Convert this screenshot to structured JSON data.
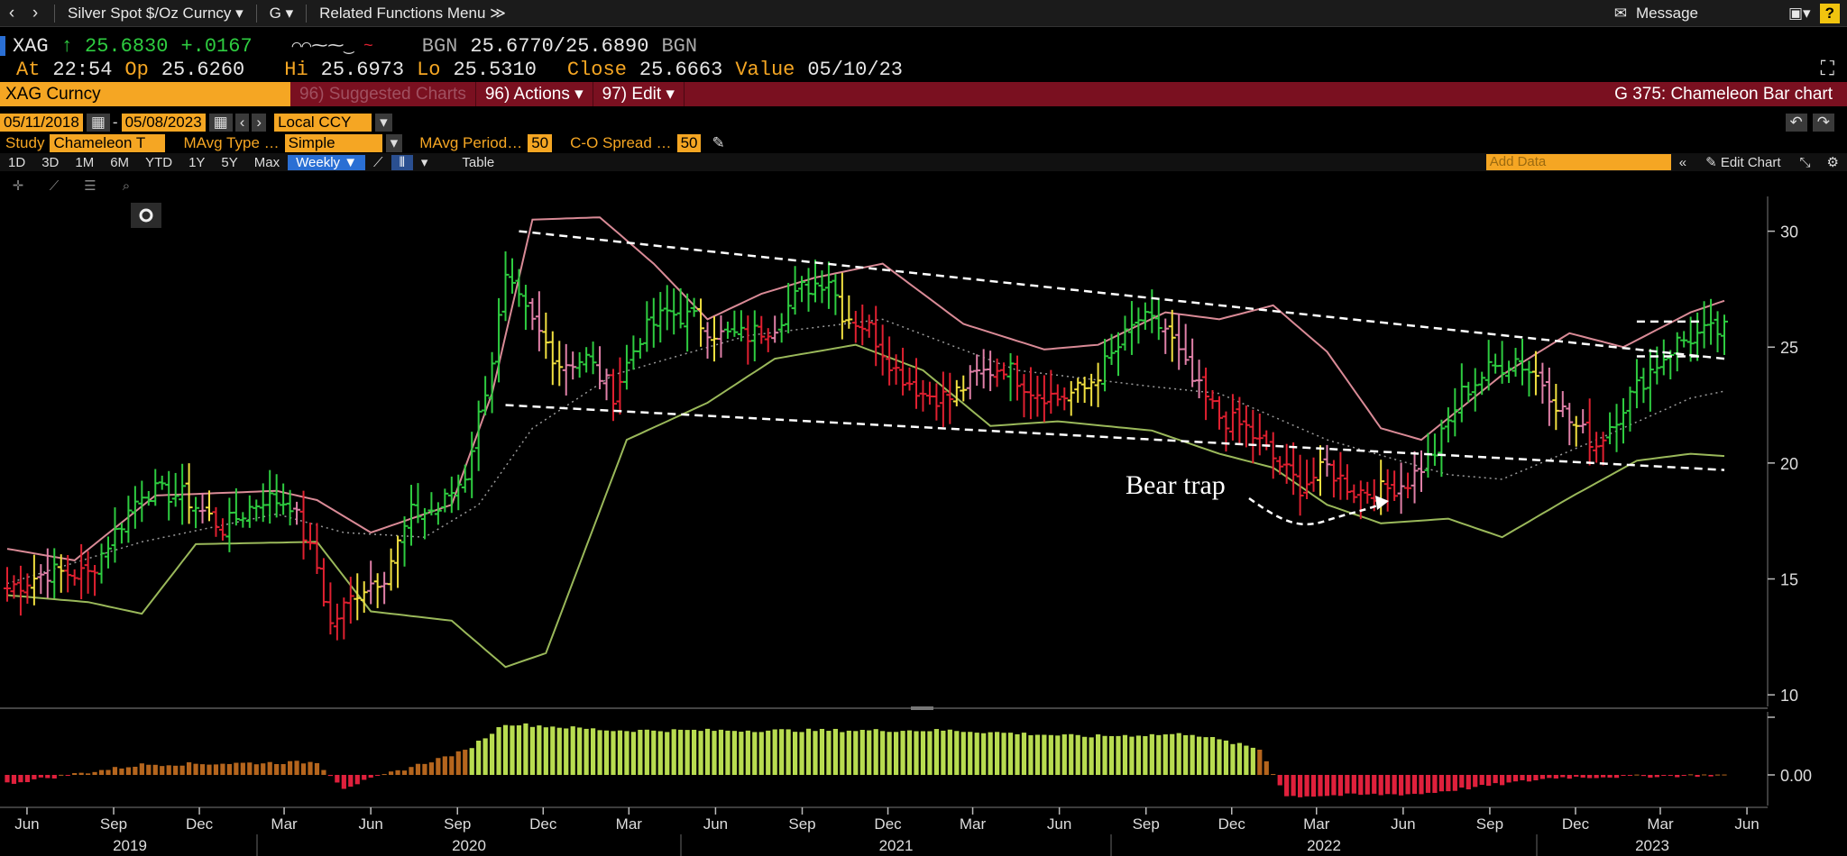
{
  "topbar": {
    "security_menu": "Silver Spot $/Oz Curncy ▾",
    "g_menu": "G ▾",
    "related": "Related Functions Menu ≫",
    "message": "Message",
    "help": "?"
  },
  "quote": {
    "ticker": "XAG",
    "last": "↑ 25.6830",
    "change": "+.0167",
    "source1": "BGN",
    "bidask": "25.6770/25.6890",
    "source2": "BGN",
    "at_label": "At",
    "time": "22:54",
    "op_label": "Op",
    "open": "25.6260",
    "hi_label": "Hi",
    "high": "25.6973",
    "lo_label": "Lo",
    "low": "25.5310",
    "close_label": "Close",
    "close": "25.6663",
    "value_label": "Value",
    "value_date": "05/10/23"
  },
  "security_bar": {
    "ticker_field": "XAG Curncy",
    "suggested": "96) Suggested Charts",
    "actions": "96) Actions ▾",
    "edit": "97) Edit ▾",
    "title": "G 375: Chameleon Bar chart"
  },
  "dates": {
    "start": "05/11/2018",
    "end": "05/08/2023",
    "currency": "Local CCY"
  },
  "study": {
    "label": "Study",
    "study_value": "Chameleon T",
    "mavg_type_label": "MAvg Type …",
    "mavg_type_value": "Simple",
    "mavg_period_label": "MAvg Period…",
    "mavg_period_value": "50",
    "co_spread_label": "C-O Spread …",
    "co_spread_value": "50"
  },
  "periods": [
    "1D",
    "3D",
    "1M",
    "6M",
    "YTD",
    "1Y",
    "5Y",
    "Max"
  ],
  "frequency": "Weekly ▼",
  "table_label": "Table",
  "add_data_placeholder": "Add Data",
  "edit_chart": "Edit Chart",
  "colors": {
    "accent": "#f5a623",
    "up": "#2ecc40",
    "down": "#e02030",
    "neutral": "#f1e040",
    "upper_band": "#d98a96",
    "lower_band": "#9ab85a"
  },
  "chart_data": {
    "type": "bar",
    "title": "",
    "annotations": [
      "Bear trap"
    ],
    "x_ticks": [
      "Jun",
      "Sep",
      "Dec",
      "Mar",
      "Jun",
      "Sep",
      "Dec",
      "Mar",
      "Jun",
      "Sep",
      "Dec",
      "Mar",
      "Jun",
      "Sep",
      "Dec",
      "Mar",
      "Jun",
      "Sep",
      "Dec",
      "Mar",
      "Jun"
    ],
    "x_years": [
      "2019",
      "2020",
      "2021",
      "2022",
      "2023"
    ],
    "y_ticks": [
      10,
      15,
      20,
      25,
      30
    ],
    "ylim": [
      9.5,
      31.5
    ],
    "lower_y_tick": "0.00",
    "anchors": [
      [
        0,
        14.6
      ],
      [
        6,
        15.3
      ],
      [
        12,
        15.2
      ],
      [
        16,
        17.0
      ],
      [
        20,
        18.8
      ],
      [
        26,
        18.6
      ],
      [
        32,
        17.2
      ],
      [
        38,
        18.5
      ],
      [
        42,
        18.3
      ],
      [
        46,
        15.5
      ],
      [
        48,
        13.0
      ],
      [
        52,
        14.5
      ],
      [
        56,
        15.2
      ],
      [
        60,
        17.8
      ],
      [
        64,
        18.0
      ],
      [
        68,
        19.5
      ],
      [
        70,
        22.0
      ],
      [
        72,
        24.5
      ],
      [
        74,
        27.8
      ],
      [
        78,
        26.0
      ],
      [
        82,
        24.3
      ],
      [
        86,
        24.5
      ],
      [
        90,
        23.0
      ],
      [
        94,
        25.5
      ],
      [
        98,
        26.5
      ],
      [
        102,
        26.2
      ],
      [
        106,
        25.5
      ],
      [
        110,
        25.5
      ],
      [
        114,
        26.0
      ],
      [
        118,
        27.5
      ],
      [
        122,
        28.0
      ],
      [
        124,
        26.5
      ],
      [
        128,
        25.8
      ],
      [
        132,
        24.0
      ],
      [
        136,
        23.0
      ],
      [
        140,
        22.8
      ],
      [
        144,
        23.8
      ],
      [
        148,
        24.2
      ],
      [
        152,
        23.2
      ],
      [
        156,
        22.8
      ],
      [
        160,
        23.2
      ],
      [
        164,
        24.6
      ],
      [
        168,
        26.2
      ],
      [
        172,
        25.8
      ],
      [
        176,
        23.5
      ],
      [
        180,
        22.0
      ],
      [
        184,
        21.5
      ],
      [
        188,
        20.2
      ],
      [
        192,
        19.0
      ],
      [
        196,
        19.8
      ],
      [
        200,
        18.8
      ],
      [
        204,
        18.8
      ],
      [
        208,
        19.2
      ],
      [
        212,
        20.5
      ],
      [
        216,
        23.0
      ],
      [
        220,
        24.0
      ],
      [
        224,
        24.5
      ],
      [
        228,
        23.5
      ],
      [
        232,
        21.8
      ],
      [
        236,
        20.8
      ],
      [
        240,
        22.5
      ],
      [
        244,
        24.0
      ],
      [
        248,
        25.2
      ],
      [
        252,
        25.6
      ],
      [
        255,
        25.7
      ]
    ],
    "n_bars": 256,
    "x_start": "2018-05-11",
    "x_end": "2023-05-08",
    "lower_panel": {
      "anchors": [
        [
          0,
          -0.1
        ],
        [
          20,
          0.12
        ],
        [
          46,
          0.15
        ],
        [
          50,
          -0.15
        ],
        [
          56,
          0.0
        ],
        [
          68,
          0.28
        ],
        [
          74,
          0.6
        ],
        [
          78,
          0.58
        ],
        [
          90,
          0.52
        ],
        [
          140,
          0.52
        ],
        [
          160,
          0.45
        ],
        [
          176,
          0.48
        ],
        [
          186,
          0.3
        ],
        [
          190,
          -0.25
        ],
        [
          210,
          -0.22
        ],
        [
          230,
          -0.03
        ],
        [
          255,
          0.0
        ]
      ]
    },
    "upper_band": [
      [
        0,
        16.3
      ],
      [
        10,
        15.8
      ],
      [
        22,
        18.6
      ],
      [
        40,
        18.8
      ],
      [
        46,
        18.4
      ],
      [
        54,
        17.0
      ],
      [
        66,
        18.2
      ],
      [
        72,
        23.0
      ],
      [
        78,
        30.5
      ],
      [
        88,
        30.6
      ],
      [
        96,
        28.6
      ],
      [
        104,
        26.2
      ],
      [
        112,
        27.3
      ],
      [
        120,
        28.0
      ],
      [
        130,
        28.6
      ],
      [
        142,
        26.0
      ],
      [
        154,
        24.9
      ],
      [
        162,
        25.1
      ],
      [
        172,
        26.5
      ],
      [
        180,
        26.2
      ],
      [
        188,
        26.8
      ],
      [
        196,
        24.8
      ],
      [
        204,
        21.5
      ],
      [
        210,
        21.0
      ],
      [
        222,
        23.8
      ],
      [
        232,
        25.6
      ],
      [
        240,
        25.0
      ],
      [
        250,
        26.5
      ],
      [
        255,
        27.0
      ]
    ],
    "lower_band": [
      [
        0,
        14.3
      ],
      [
        12,
        14.0
      ],
      [
        20,
        13.5
      ],
      [
        28,
        16.5
      ],
      [
        46,
        16.6
      ],
      [
        54,
        13.6
      ],
      [
        66,
        13.2
      ],
      [
        74,
        11.2
      ],
      [
        80,
        11.8
      ],
      [
        92,
        21.0
      ],
      [
        104,
        22.6
      ],
      [
        114,
        24.5
      ],
      [
        126,
        25.1
      ],
      [
        136,
        24.0
      ],
      [
        146,
        21.6
      ],
      [
        156,
        21.8
      ],
      [
        170,
        21.4
      ],
      [
        180,
        20.4
      ],
      [
        188,
        19.8
      ],
      [
        196,
        18.2
      ],
      [
        204,
        17.4
      ],
      [
        214,
        17.6
      ],
      [
        222,
        16.8
      ],
      [
        232,
        18.5
      ],
      [
        242,
        20.1
      ],
      [
        250,
        20.4
      ],
      [
        255,
        20.3
      ]
    ],
    "mavg": [
      [
        0,
        14.8
      ],
      [
        20,
        16.6
      ],
      [
        40,
        17.8
      ],
      [
        50,
        17.0
      ],
      [
        62,
        16.8
      ],
      [
        70,
        18.2
      ],
      [
        78,
        21.5
      ],
      [
        90,
        23.8
      ],
      [
        110,
        25.5
      ],
      [
        130,
        26.2
      ],
      [
        150,
        24.0
      ],
      [
        170,
        23.3
      ],
      [
        180,
        23.0
      ],
      [
        196,
        21.0
      ],
      [
        214,
        19.5
      ],
      [
        222,
        19.3
      ],
      [
        236,
        21.0
      ],
      [
        250,
        22.8
      ],
      [
        255,
        23.1
      ]
    ],
    "trend_lines": [
      {
        "from": [
          76,
          30.0
        ],
        "to": [
          255,
          24.5
        ]
      },
      {
        "from": [
          74,
          22.5
        ],
        "to": [
          255,
          19.7
        ]
      },
      {
        "from": [
          242,
          26.1
        ],
        "to": [
          252,
          26.1
        ]
      },
      {
        "from": [
          242,
          24.6
        ],
        "to": [
          252,
          24.6
        ]
      }
    ]
  }
}
